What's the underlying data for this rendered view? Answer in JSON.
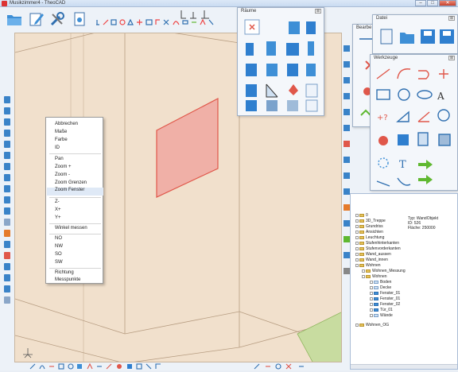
{
  "window": {
    "title": "Musikzimmer4 - TheoCAD",
    "controls": {
      "minimize": "–",
      "maximize": "□",
      "close": "✕"
    }
  },
  "context_menu": {
    "items": [
      {
        "label": "Abbrechen"
      },
      {
        "label": "Maße"
      },
      {
        "label": "Farbe"
      },
      {
        "label": "ID"
      },
      {
        "label": "Pan"
      },
      {
        "label": "Zoom +"
      },
      {
        "label": "Zoom -"
      },
      {
        "label": "Zoom Grenzen"
      },
      {
        "label": "Zoom Fenster",
        "highlighted": true
      },
      {
        "label": "Z-"
      },
      {
        "label": "X+"
      },
      {
        "label": "Y+"
      },
      {
        "label": "Winkel messen"
      },
      {
        "label": "NO"
      },
      {
        "label": "NW"
      },
      {
        "label": "SO"
      },
      {
        "label": "SW"
      },
      {
        "label": "Richtung"
      },
      {
        "label": "Messpunkte"
      }
    ]
  },
  "panels": {
    "raeume": {
      "title": "Räume",
      "close": "⊠"
    },
    "datei": {
      "title": "Datei",
      "close": "⊠"
    },
    "werkzeuge": {
      "title": "Werkzeuge",
      "close": "⊠"
    },
    "bearbeiten": {
      "title": "Bearbe"
    }
  },
  "tree": {
    "rows": [
      {
        "label": "0"
      },
      {
        "label": "3D_Treppe"
      },
      {
        "label": "Grundriss"
      },
      {
        "label": "Ansichten"
      },
      {
        "label": "Leuchtung"
      },
      {
        "label": "Stufenhinterkanten"
      },
      {
        "label": "Stufenvorderkanten"
      },
      {
        "label": "Wand_aussen"
      },
      {
        "label": "Wand_innen"
      },
      {
        "label": "Wohnen"
      },
      {
        "label": "Wohnen_Messung"
      },
      {
        "label": "Wohnen"
      },
      {
        "label": "Boden"
      },
      {
        "label": "Decke"
      },
      {
        "label": "Fenster_01"
      },
      {
        "label": "Fenster_01"
      },
      {
        "label": "Fenster_02"
      },
      {
        "label": "Tür_01"
      },
      {
        "label": "Wände"
      },
      {
        "label": "Wohnen_OG"
      }
    ],
    "info": {
      "typ": "Typ: WandObjekt",
      "id": "ID: 526",
      "flaeche": "Fläche: 250000"
    }
  },
  "colors": {
    "viewport_bg": "#f1e0cc",
    "panel_icon_blue": "#2f7fcf",
    "selection_red": "#e0574a",
    "arrow_green": "#5fb830"
  },
  "icons": [
    "folder-icon",
    "pencil-icon",
    "tools-icon",
    "document-icon",
    "save-icon",
    "line-icon",
    "arc-icon",
    "rectangle-icon",
    "circle-icon",
    "text-icon",
    "arrow-right-icon",
    "axis-icon"
  ]
}
